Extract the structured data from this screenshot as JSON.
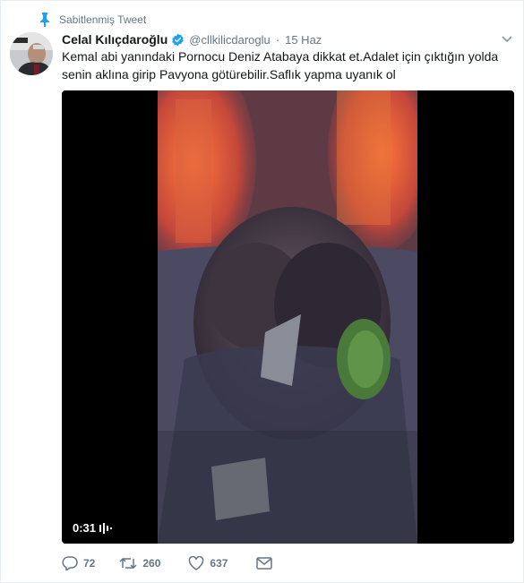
{
  "pinned": {
    "label": "Sabitlenmiş Tweet",
    "icon": "pin-icon"
  },
  "author": {
    "fullname": "Celal Kılıçdaroğlu",
    "username": "@cllkilicdaroglu",
    "verified": true,
    "timestamp": "15 Haz"
  },
  "tweet": {
    "text_line1": "Kemal abi yanındaki Pornocu Deniz Atabaya dikkat et.Adalet için çıktığın yolda",
    "text_line2": "senin aklına girip Pavyona götürebilir.Saflık yapma uyanık ol"
  },
  "media": {
    "duration": "0:31",
    "type": "video"
  },
  "actions": {
    "replies": "72",
    "retweets": "260",
    "likes": "637"
  },
  "colors": {
    "accent": "#1da1f2",
    "muted": "#657786",
    "text": "#14171a"
  }
}
